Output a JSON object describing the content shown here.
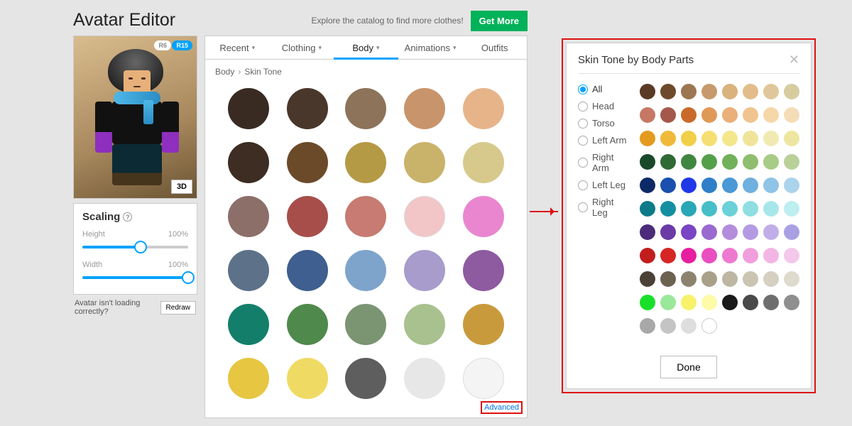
{
  "page_title": "Avatar Editor",
  "topbar": {
    "explore": "Explore the catalog to find more clothes!",
    "get_more": "Get More"
  },
  "avatar": {
    "r6": "R6",
    "r15": "R15",
    "btn_3d": "3D"
  },
  "scaling": {
    "title": "Scaling",
    "height_label": "Height",
    "height_value": "100%",
    "height_pct": 55,
    "width_label": "Width",
    "width_value": "100%",
    "width_pct": 100
  },
  "redraw": {
    "text": "Avatar isn't loading correctly?",
    "btn": "Redraw"
  },
  "tabs": {
    "items": [
      "Recent",
      "Clothing",
      "Body",
      "Animations",
      "Outfits"
    ],
    "active": 2
  },
  "crumb": {
    "a": "Body",
    "b": "Skin Tone"
  },
  "colors": [
    "#3a2b22",
    "#4a372b",
    "#8c735a",
    "#c8946b",
    "#e7b48a",
    "#3d2d22",
    "#6b4a2a",
    "#b59a46",
    "#c9b26a",
    "#d7c98b",
    "#8d6f6a",
    "#a84e4a",
    "#c77b72",
    "#f2c6c6",
    "#e986cf",
    "#5d7189",
    "#3e5f8f",
    "#7ea4cc",
    "#a79ccc",
    "#8e5aa0",
    "#137f6b",
    "#4f8a4c",
    "#7b9472",
    "#a8c18e",
    "#c99a3c",
    "#e7c642",
    "#efdb63",
    "#5e5e5e",
    "#e7e7e7",
    "#f4f4f4"
  ],
  "advanced": "Advanced",
  "modal": {
    "title": "Skin Tone by Body Parts",
    "done": "Done",
    "parts": [
      "All",
      "Head",
      "Torso",
      "Left Arm",
      "Right Arm",
      "Left Leg",
      "Right Leg"
    ],
    "selected": 0,
    "colors": [
      "#5a3a24",
      "#6e4a2c",
      "#9c7650",
      "#c79a6d",
      "#d9b27e",
      "#e2bd8b",
      "#e0c79b",
      "#d6cc9e",
      "#c77864",
      "#a4584a",
      "#c96a2a",
      "#e09a57",
      "#eab079",
      "#f0c48f",
      "#f5d7a8",
      "#f4ddb6",
      "#e39a1e",
      "#efb93a",
      "#f1cf49",
      "#f5df72",
      "#f4e78b",
      "#efe49a",
      "#f0eab2",
      "#eee6a0",
      "#184a2a",
      "#2f6a34",
      "#3f8640",
      "#54a04a",
      "#72b05a",
      "#8fbe6f",
      "#a8cb85",
      "#b9d198",
      "#0c2a66",
      "#1a4fae",
      "#2138e8",
      "#2f7ec8",
      "#4a98d6",
      "#6fb0de",
      "#8fc4e6",
      "#abd3ec",
      "#0d7a8a",
      "#158fa0",
      "#28a7b6",
      "#46bec8",
      "#6ad1d8",
      "#8edee2",
      "#a7e7ea",
      "#bdeef0",
      "#4b2b7a",
      "#6a3aa6",
      "#7a45c4",
      "#9a6ad0",
      "#b48cdc",
      "#b49ae2",
      "#c1aee8",
      "#a9a0e4",
      "#c21d1d",
      "#d62525",
      "#e71ea0",
      "#e94fc0",
      "#ee7ad0",
      "#f09edc",
      "#f2b6e4",
      "#f3c8ea",
      "#4a4236",
      "#6b6250",
      "#8c836e",
      "#a9a08a",
      "#bdb6a2",
      "#cac4b2",
      "#d5d0c2",
      "#dedacd",
      "#18e02a",
      "#9ae89a",
      "#f7f26a",
      "#fdfaa8",
      "#1a1a1a",
      "#4a4a4a",
      "#6e6e6e",
      "#8f8f8f",
      "#a8a8a8",
      "#c4c4c4",
      "#dedede",
      "#ffffff"
    ]
  }
}
